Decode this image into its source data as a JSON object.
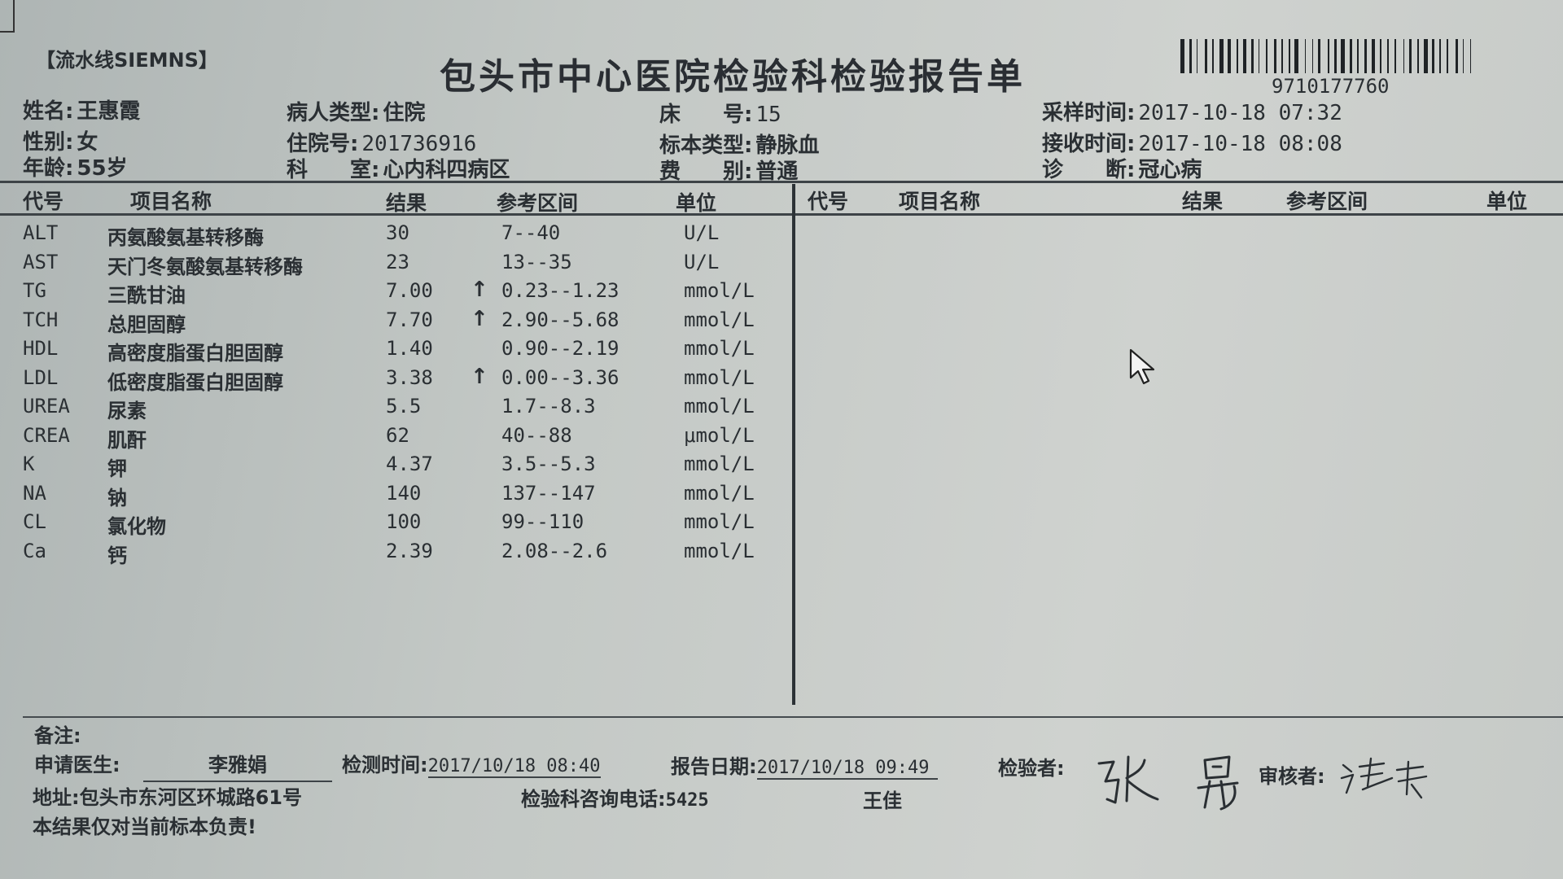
{
  "header": {
    "line_tag": "【流水线SIEMNS】",
    "title": "包头市中心医院检验科检验报告单",
    "barcode_number": "9710177760"
  },
  "patient": {
    "name_label": "姓名:",
    "name": "王惠霞",
    "sex_label": "性别:",
    "sex": "女",
    "age_label": "年龄:",
    "age": "55岁",
    "type_label": "病人类型:",
    "type": "住院",
    "admission_label": "住院号:",
    "admission": "201736916",
    "dept_label": "科　　室:",
    "dept": "心内科四病区",
    "bed_label": "床　　号:",
    "bed": "15",
    "specimen_label": "标本类型:",
    "specimen": "静脉血",
    "fee_label": "费　　别:",
    "fee": "普通",
    "sample_time_label": "采样时间:",
    "sample_time": "2017-10-18 07:32",
    "receive_time_label": "接收时间:",
    "receive_time": "2017-10-18 08:08",
    "diagnosis_label": "诊　　断:",
    "diagnosis": "冠心病"
  },
  "columns": {
    "code": "代号",
    "name": "项目名称",
    "result": "结果",
    "range": "参考区间",
    "unit": "单位"
  },
  "results": [
    {
      "code": "ALT",
      "name": "丙氨酸氨基转移酶",
      "result": "30",
      "flag": "",
      "range": "7--40",
      "unit": "U/L"
    },
    {
      "code": "AST",
      "name": "天门冬氨酸氨基转移酶",
      "result": "23",
      "flag": "",
      "range": "13--35",
      "unit": "U/L"
    },
    {
      "code": "TG",
      "name": "三酰甘油",
      "result": "7.00",
      "flag": "↑",
      "range": "0.23--1.23",
      "unit": "mmol/L"
    },
    {
      "code": "TCH",
      "name": "总胆固醇",
      "result": "7.70",
      "flag": "↑",
      "range": "2.90--5.68",
      "unit": "mmol/L"
    },
    {
      "code": "HDL",
      "name": "高密度脂蛋白胆固醇",
      "result": "1.40",
      "flag": "",
      "range": "0.90--2.19",
      "unit": "mmol/L"
    },
    {
      "code": "LDL",
      "name": "低密度脂蛋白胆固醇",
      "result": "3.38",
      "flag": "↑",
      "range": "0.00--3.36",
      "unit": "mmol/L"
    },
    {
      "code": "UREA",
      "name": "尿素",
      "result": "5.5",
      "flag": "",
      "range": "1.7--8.3",
      "unit": "mmol/L"
    },
    {
      "code": "CREA",
      "name": "肌酐",
      "result": "62",
      "flag": "",
      "range": "40--88",
      "unit": "μmol/L"
    },
    {
      "code": "K",
      "name": "钾",
      "result": "4.37",
      "flag": "",
      "range": "3.5--5.3",
      "unit": "mmol/L"
    },
    {
      "code": "NA",
      "name": "钠",
      "result": "140",
      "flag": "",
      "range": "137--147",
      "unit": "mmol/L"
    },
    {
      "code": "CL",
      "name": "氯化物",
      "result": "100",
      "flag": "",
      "range": "99--110",
      "unit": "mmol/L"
    },
    {
      "code": "Ca",
      "name": "钙",
      "result": "2.39",
      "flag": "",
      "range": "2.08--2.6",
      "unit": "mmol/L"
    }
  ],
  "footer": {
    "remark_label": "备注:",
    "doctor_label": "申请医生:",
    "doctor": "李雅娟",
    "test_time_label": "检测时间:",
    "test_time": "2017/10/18 08:40",
    "report_date_label": "报告日期:",
    "report_date": "2017/10/18 09:49",
    "tester_label": "检验者:",
    "tester_signature": "张鼎",
    "reviewer_label": "审核者:",
    "address_label": "地址:",
    "address": "包头市东河区环城路61号",
    "phone_label": "检验科咨询电话:",
    "phone": "5425",
    "phone_contact": "王佳",
    "disclaimer": "本结果仅对当前标本负责!"
  },
  "colors": {
    "ink": "#2a2f33",
    "paper": "#c6cac7",
    "rule": "#3d4347"
  }
}
